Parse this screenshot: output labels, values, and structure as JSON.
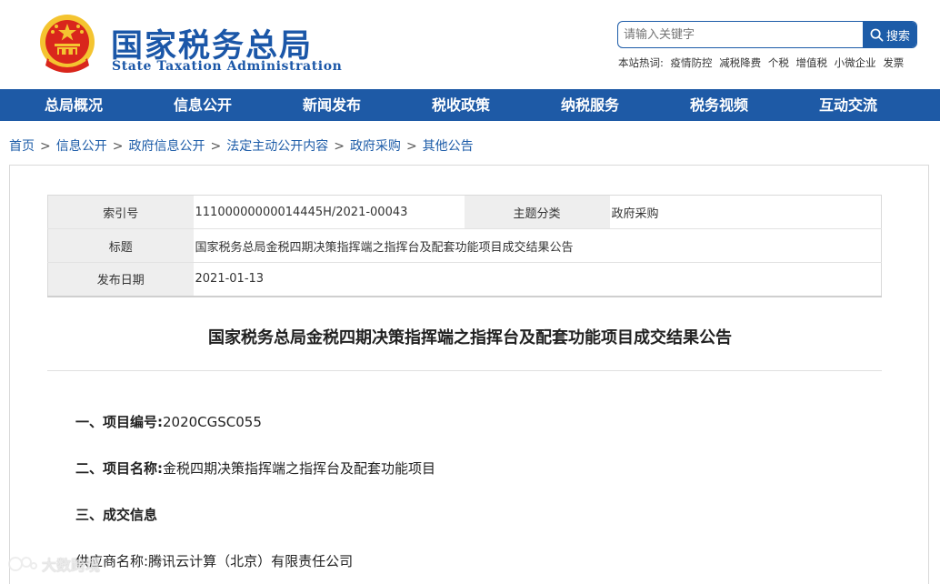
{
  "header": {
    "logo_cn": "国家税务总局",
    "logo_en": "State Taxation Administration",
    "search": {
      "placeholder": "请输入关键字",
      "button_label": "搜索"
    },
    "hotwords": {
      "label": "本站热词:",
      "items": [
        "疫情防控",
        "减税降费",
        "个税",
        "增值税",
        "小微企业",
        "发票"
      ]
    }
  },
  "nav": {
    "items": [
      "总局概况",
      "信息公开",
      "新闻发布",
      "税收政策",
      "纳税服务",
      "税务视频",
      "互动交流"
    ]
  },
  "breadcrumb": {
    "items": [
      "首页",
      "信息公开",
      "政府信息公开",
      "法定主动公开内容",
      "政府采购",
      "其他公告"
    ],
    "separator": ">"
  },
  "meta": {
    "index_label": "索引号",
    "index_value": "11100000000014445H/2021-00043",
    "category_label": "主题分类",
    "category_value": "政府采购",
    "title_label": "标题",
    "title_value": "国家税务总局金税四期决策指挥端之指挥台及配套功能项目成交结果公告",
    "date_label": "发布日期",
    "date_value": "2021-01-13"
  },
  "article": {
    "title": "国家税务总局金税四期决策指挥端之指挥台及配套功能项目成交结果公告",
    "sections": [
      {
        "heading": "一、项目编号:",
        "text": "2020CGSC055"
      },
      {
        "heading": "二、项目名称:",
        "text": "金税四期决策指挥端之指挥台及配套功能项目"
      },
      {
        "heading": "三、成交信息",
        "text": ""
      }
    ],
    "supplier_label": "供应商名称:",
    "supplier_value": "腾讯云计算（北京）有限责任公司"
  },
  "watermark": {
    "text": "大数跨境"
  },
  "colors": {
    "brand_blue": "#1d5ca8",
    "nav_blue": "#1e5aa6",
    "emblem_red": "#d9261c",
    "emblem_gold": "#f4c430"
  },
  "icons": [
    "national-emblem-icon",
    "search-icon",
    "watermark-logo-icon"
  ]
}
